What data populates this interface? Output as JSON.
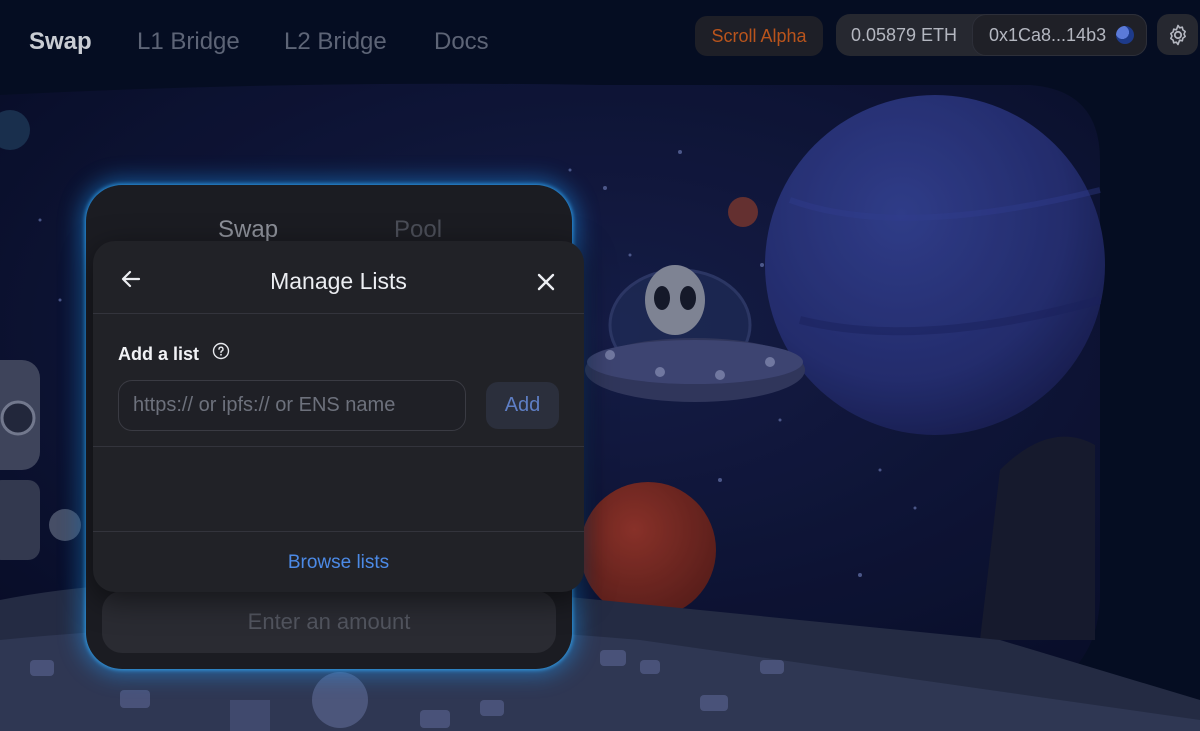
{
  "nav": {
    "links": [
      {
        "label": "Swap"
      },
      {
        "label": "L1 Bridge"
      },
      {
        "label": "L2 Bridge"
      },
      {
        "label": "Docs"
      }
    ],
    "network_badge": "Scroll Alpha",
    "balance": "0.05879 ETH",
    "address": "0x1Ca8...14b3",
    "settings_icon": "gear-icon"
  },
  "swap_card": {
    "tabs": [
      {
        "label": "Swap"
      },
      {
        "label": "Pool"
      }
    ],
    "cta": "Enter an amount"
  },
  "modal": {
    "title": "Manage Lists",
    "back_icon": "arrow-left-icon",
    "close_icon": "close-icon",
    "add_list_label": "Add a list",
    "help_icon": "question-circle-icon",
    "input_placeholder": "https:// or ipfs:// or ENS name",
    "input_value": "",
    "add_button": "Add",
    "browse_link": "Browse lists"
  },
  "colors": {
    "accent_link": "#4c8ae6",
    "network_badge_text": "#b9541c",
    "glow": "#1ea0ff"
  }
}
